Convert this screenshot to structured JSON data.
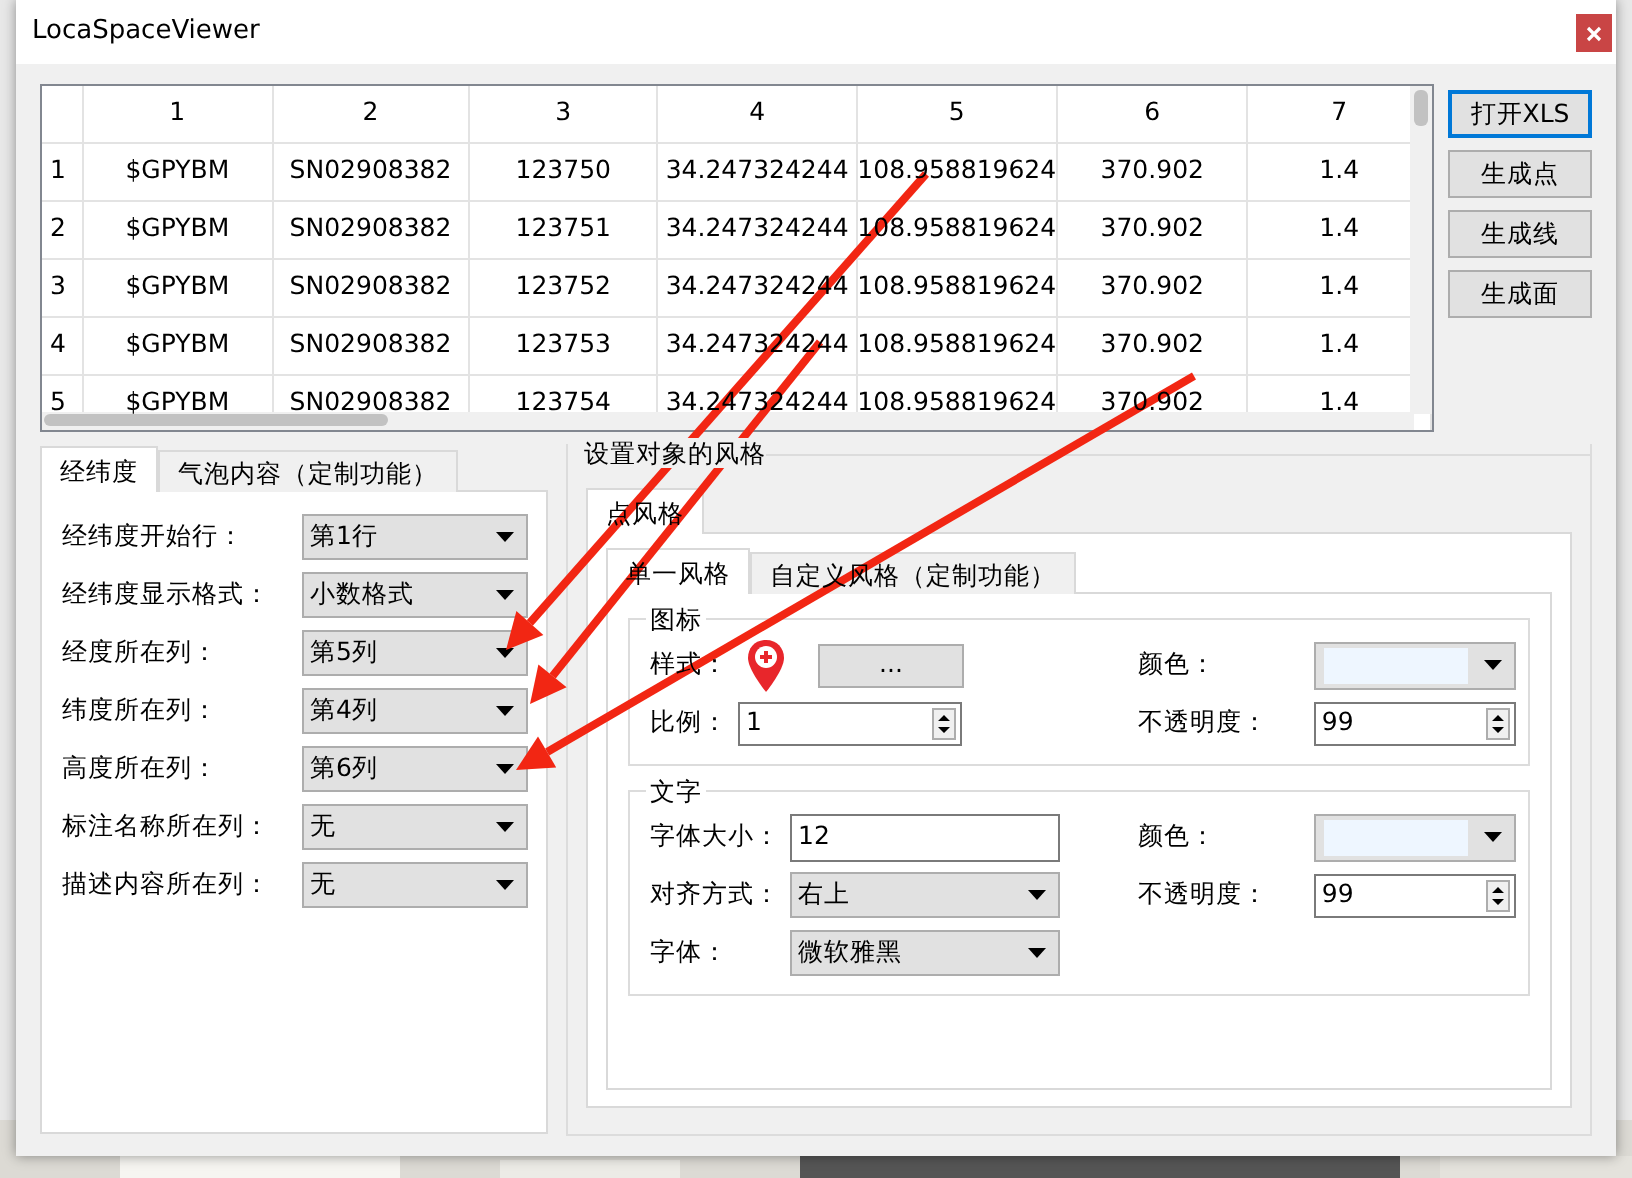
{
  "window": {
    "title": "LocaSpaceViewer"
  },
  "table": {
    "columns": [
      "1",
      "2",
      "3",
      "4",
      "5",
      "6",
      "7"
    ],
    "rows": [
      {
        "header": "1",
        "cells": [
          "$GPYBM",
          "SN02908382",
          "123750",
          "34.247324244",
          "108.958819624",
          "370.902",
          "1.4"
        ]
      },
      {
        "header": "2",
        "cells": [
          "$GPYBM",
          "SN02908382",
          "123751",
          "34.247324244",
          "108.958819624",
          "370.902",
          "1.4"
        ]
      },
      {
        "header": "3",
        "cells": [
          "$GPYBM",
          "SN02908382",
          "123752",
          "34.247324244",
          "108.958819624",
          "370.902",
          "1.4"
        ]
      },
      {
        "header": "4",
        "cells": [
          "$GPYBM",
          "SN02908382",
          "123753",
          "34.247324244",
          "108.958819624",
          "370.902",
          "1.4"
        ]
      },
      {
        "header": "5",
        "cells": [
          "$GPYBM",
          "SN02908382",
          "123754",
          "34.247324244",
          "108.958819624",
          "370.902",
          "1.4"
        ]
      }
    ]
  },
  "buttons": [
    {
      "label": "打开XLS",
      "focused": true
    },
    {
      "label": "生成点",
      "focused": false
    },
    {
      "label": "生成线",
      "focused": false
    },
    {
      "label": "生成面",
      "focused": false
    }
  ],
  "left_tabs": [
    {
      "label": "经纬度",
      "selected": true
    },
    {
      "label": "气泡内容（定制功能）",
      "selected": false
    }
  ],
  "left_fields": [
    {
      "label": "经纬度开始行：",
      "value": "第1行"
    },
    {
      "label": "经纬度显示格式：",
      "value": "小数格式"
    },
    {
      "label": "经度所在列：",
      "value": "第5列"
    },
    {
      "label": "纬度所在列：",
      "value": "第4列"
    },
    {
      "label": "高度所在列：",
      "value": "第6列"
    },
    {
      "label": "标注名称所在列：",
      "value": "无"
    },
    {
      "label": "描述内容所在列：",
      "value": "无"
    }
  ],
  "style_panel": {
    "title": "设置对象的风格",
    "tabs": [
      {
        "label": "点风格",
        "selected": true
      }
    ],
    "sub_tabs": [
      {
        "label": "单一风格",
        "selected": true
      },
      {
        "label": "自定义风格（定制功能）",
        "selected": false
      }
    ],
    "groups": [
      {
        "title": "图标",
        "rows": [
          [
            {
              "label": "样式：",
              "kind": "icon_button",
              "value": "..."
            },
            {
              "label": "颜色：",
              "kind": "color",
              "color": "#eef6ff"
            }
          ],
          [
            {
              "label": "比例：",
              "kind": "spin",
              "value": "1"
            },
            {
              "label": "不透明度：",
              "kind": "spin",
              "value": "99"
            }
          ]
        ]
      },
      {
        "title": "文字",
        "rows": [
          [
            {
              "label": "字体大小：",
              "kind": "text",
              "value": "12"
            },
            {
              "label": "颜色：",
              "kind": "color",
              "color": "#eef6ff"
            }
          ],
          [
            {
              "label": "对齐方式：",
              "kind": "combo",
              "value": "右上"
            },
            {
              "label": "不透明度：",
              "kind": "spin",
              "value": "99"
            }
          ],
          [
            {
              "label": "字体：",
              "kind": "combo",
              "value": "微软雅黑"
            }
          ]
        ]
      }
    ]
  }
}
